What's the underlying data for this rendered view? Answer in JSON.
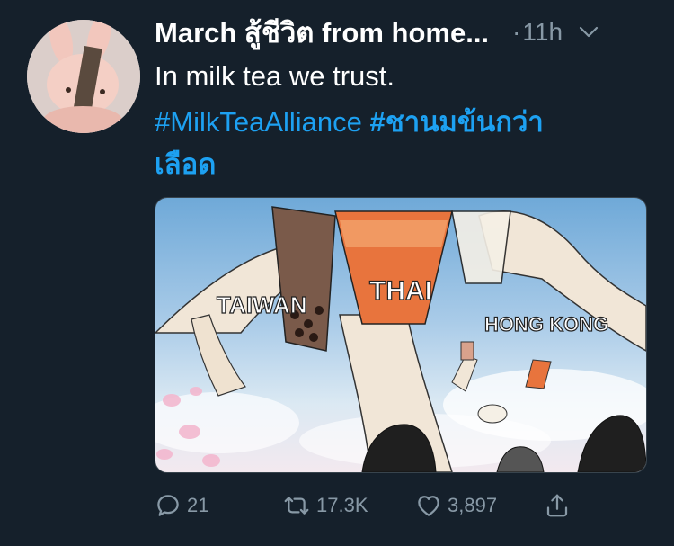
{
  "tweet": {
    "display_name": "March สู้ชีวิต from home...",
    "separator": "·",
    "timestamp": "11h",
    "text": "In milk tea we trust.",
    "hashtags": {
      "first": "#MilkTeaAlliance",
      "second_line1": "#ชานมข้นกว่า",
      "second_line2": "เลือด"
    },
    "media": {
      "labels": {
        "left": "TAIWAN",
        "center": "THAI",
        "right": "HONG KONG"
      }
    },
    "actions": {
      "reply_count": "21",
      "retweet_count": "17.3K",
      "like_count": "3,897"
    }
  },
  "colors": {
    "background": "#15202b",
    "link": "#1da1f2",
    "secondary_text": "#8899a6",
    "primary_text": "#ffffff"
  }
}
